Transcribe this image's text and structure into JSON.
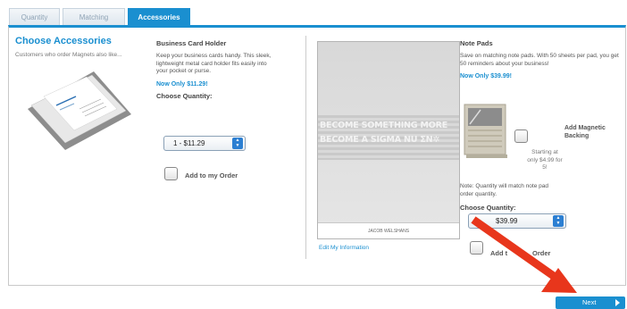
{
  "tabs": [
    {
      "label": "Quantity"
    },
    {
      "label": "Matching"
    },
    {
      "label": "Accessories"
    }
  ],
  "section": {
    "title": "Choose Accessories",
    "subtitle": "Customers who order Magnets also like..."
  },
  "business_card": {
    "title": "Business Card Holder",
    "description": "Keep your business cards handy. This sleek, lightweight metal card holder fits easily into your pocket or purse.",
    "price": "Now Only $11.29!",
    "choose_label": "Choose Quantity:",
    "selected": "1 - $11.29",
    "add_label": "Add to my Order"
  },
  "preview": {
    "motto_line1": "BECOME SOMETHING MORE",
    "motto_line2": "BECOME A SIGMA NU ΣN✲",
    "name": "JACOB WELSHANS",
    "edit_link": "Edit My Information"
  },
  "note_pads": {
    "title": "Note Pads",
    "description": "Save on matching note pads. With 50 sheets per pad, you get 50 reminders about your business!",
    "price": "Now Only $39.99!",
    "magnetic_label": "Add Magnetic Backing",
    "starting": "Starting at only $4.99 for 5!",
    "note": "Note: Quantity will match note pad order quantity.",
    "choose_label": "Choose Quantity:",
    "selected": "$39.99",
    "add_label_left": "Add t",
    "add_label_right": "Order"
  },
  "footer": {
    "next_label": "Next"
  },
  "colors": {
    "accent": "#1a8fd0",
    "annotation_arrow": "#e8361c"
  }
}
